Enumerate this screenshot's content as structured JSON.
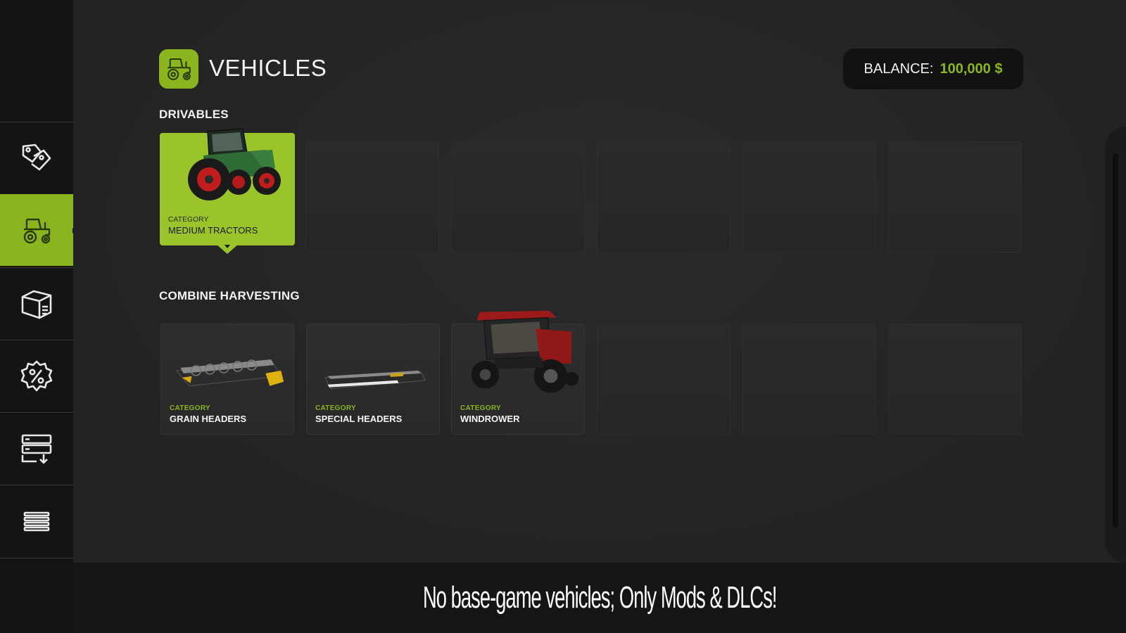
{
  "sidebar": {
    "items": [
      {
        "name": "shop-tags",
        "icon": "price-tags-icon"
      },
      {
        "name": "vehicles",
        "icon": "tractor-icon",
        "active": true
      },
      {
        "name": "objects",
        "icon": "box-icon"
      },
      {
        "name": "sales",
        "icon": "percent-badge-icon"
      },
      {
        "name": "storage",
        "icon": "storage-download-icon"
      },
      {
        "name": "menu",
        "icon": "list-icon"
      }
    ]
  },
  "header": {
    "title": "VEHICLES",
    "balance_label": "BALANCE:",
    "balance_value": "100,000 $"
  },
  "sections": {
    "drivables": {
      "heading": "DRIVABLES",
      "cards": [
        {
          "category_label": "CATEGORY",
          "category_name": "MEDIUM TRACTORS",
          "selected": true
        }
      ]
    },
    "combine": {
      "heading": "COMBINE HARVESTING",
      "cards": [
        {
          "category_label": "CATEGORY",
          "category_name": "GRAIN HEADERS"
        },
        {
          "category_label": "CATEGORY",
          "category_name": "SPECIAL HEADERS"
        },
        {
          "category_label": "CATEGORY",
          "category_name": "WINDROWER"
        }
      ]
    }
  },
  "footer": {
    "banner": "No base-game vehicles; Only Mods & DLCs!"
  },
  "colors": {
    "accent": "#8ab51f",
    "background": "#252525",
    "sidebar": "#141414"
  }
}
